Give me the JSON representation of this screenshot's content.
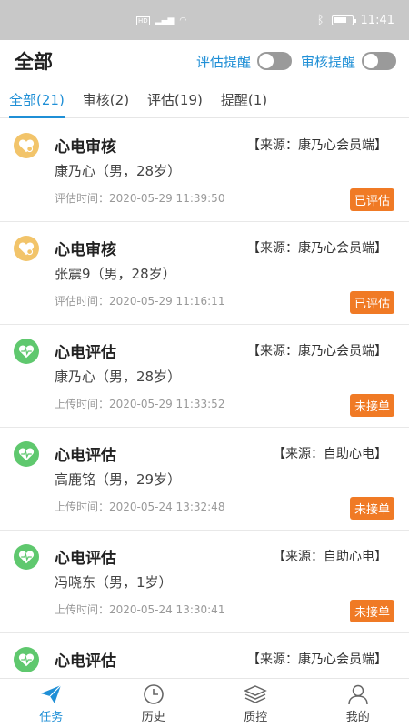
{
  "statusbar": {
    "time": "11:41"
  },
  "header": {
    "title": "全部"
  },
  "toggles": [
    {
      "label": "评估提醒",
      "on": false
    },
    {
      "label": "审核提醒",
      "on": false
    }
  ],
  "tabs": [
    {
      "label": "全部(21)",
      "active": true
    },
    {
      "label": "审核(2)",
      "active": false
    },
    {
      "label": "评估(19)",
      "active": false
    },
    {
      "label": "提醒(1)",
      "active": false
    }
  ],
  "cards": [
    {
      "type": "audit",
      "icon": "heart-audit-icon",
      "title": "心电审核",
      "source": "【来源：康乃心会员端】",
      "person": "康乃心（男，28岁）",
      "time": "评估时间：2020-05-29 11:39:50",
      "status": "已评估"
    },
    {
      "type": "audit",
      "icon": "heart-audit-icon",
      "title": "心电审核",
      "source": "【来源：康乃心会员端】",
      "person": "张震9（男，28岁）",
      "time": "评估时间：2020-05-29 11:16:11",
      "status": "已评估"
    },
    {
      "type": "eval",
      "icon": "heart-pulse-icon",
      "title": "心电评估",
      "source": "【来源：康乃心会员端】",
      "person": "康乃心（男，28岁）",
      "time": "上传时间：2020-05-29 11:33:52",
      "status": "未接单"
    },
    {
      "type": "eval",
      "icon": "heart-pulse-icon",
      "title": "心电评估",
      "source": "【来源：自助心电】",
      "person": "高鹿铭（男，29岁）",
      "time": "上传时间：2020-05-24 13:32:48",
      "status": "未接单"
    },
    {
      "type": "eval",
      "icon": "heart-pulse-icon",
      "title": "心电评估",
      "source": "【来源：自助心电】",
      "person": "冯晓东（男，1岁）",
      "time": "上传时间：2020-05-24 13:30:41",
      "status": "未接单"
    },
    {
      "type": "eval",
      "icon": "heart-pulse-icon",
      "title": "心电评估",
      "source": "【来源：康乃心会员端】",
      "person": "",
      "time": "",
      "status": ""
    }
  ],
  "nav": [
    {
      "label": "任务",
      "icon": "paper-plane-icon",
      "active": true
    },
    {
      "label": "历史",
      "icon": "clock-icon",
      "active": false
    },
    {
      "label": "质控",
      "icon": "layers-icon",
      "active": false
    },
    {
      "label": "我的",
      "icon": "user-icon",
      "active": false
    }
  ],
  "colors": {
    "accent": "#1f8fd6",
    "badge": "#f07a25",
    "audit_icon": "#f2c46a",
    "eval_icon": "#5fc86e"
  }
}
